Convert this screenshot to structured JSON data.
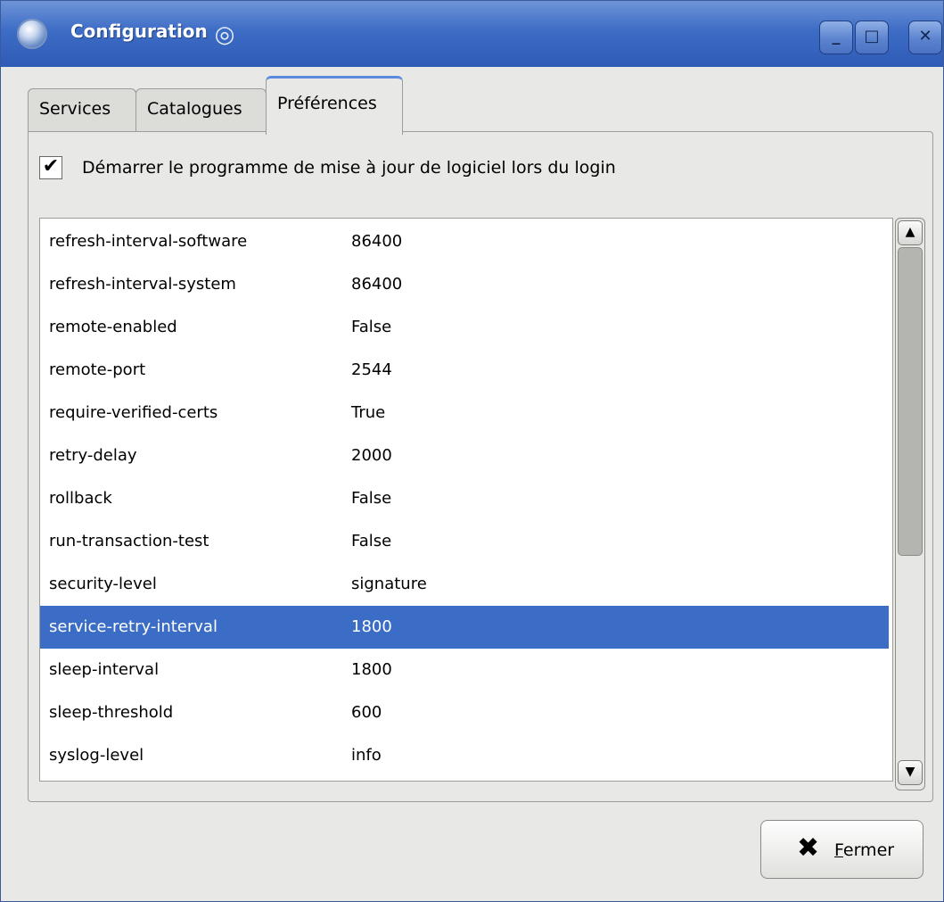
{
  "window": {
    "title": "Configuration",
    "controls": {
      "minimize": "minimize-icon",
      "maximize": "maximize-icon",
      "close": "close-icon"
    }
  },
  "tabs": [
    {
      "label": "Services",
      "active": false
    },
    {
      "label": "Catalogues",
      "active": false
    },
    {
      "label": "Préférences",
      "active": true
    }
  ],
  "preferences": {
    "start_on_login_label": "Démarrer le programme de mise à jour de logiciel lors du login",
    "start_on_login_checked": true,
    "settings": [
      {
        "key": "refresh-interval-software",
        "value": "86400"
      },
      {
        "key": "refresh-interval-system",
        "value": "86400"
      },
      {
        "key": "remote-enabled",
        "value": "False"
      },
      {
        "key": "remote-port",
        "value": "2544"
      },
      {
        "key": "require-verified-certs",
        "value": "True"
      },
      {
        "key": "retry-delay",
        "value": "2000"
      },
      {
        "key": "rollback",
        "value": "False"
      },
      {
        "key": "run-transaction-test",
        "value": "False"
      },
      {
        "key": "security-level",
        "value": "signature"
      },
      {
        "key": "service-retry-interval",
        "value": "1800"
      },
      {
        "key": "sleep-interval",
        "value": "1800"
      },
      {
        "key": "sleep-threshold",
        "value": "600"
      },
      {
        "key": "syslog-level",
        "value": "info"
      }
    ],
    "selected_index": 9,
    "scroll_position_fraction": 1.0
  },
  "footer": {
    "close_label_first": "F",
    "close_label_rest": "ermer"
  },
  "colors": {
    "titlebar": "#3d6cc5",
    "selection": "#3b6dc7",
    "active_tab_accent": "#5b8ae0"
  }
}
